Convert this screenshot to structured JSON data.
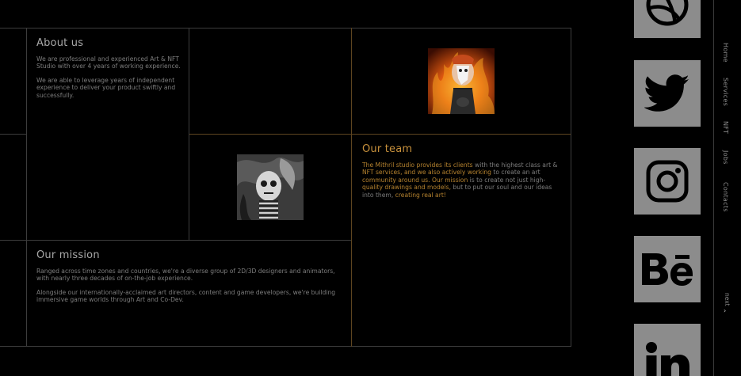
{
  "about": {
    "title": "About us",
    "p1": "We are professional and experienced Art & NFT Studio with over 4 years of working experience.",
    "p2": "We are able to leverage years of independent experience to deliver your product swiftly and successfully."
  },
  "team": {
    "title": "Our team",
    "p_a": "The Mithril studio provides its clients",
    "p_b": " with the highest class art & ",
    "p_c": "NFT services, and we also actively working",
    "p_d": " to create an art ",
    "p_e": "community around us. Our mission",
    "p_f": " is to create not just high-",
    "p_g": "quality drawings and models,",
    "p_h": " but to put our soul and our ideas into them, ",
    "p_i": "creating real art!"
  },
  "mission": {
    "title": "Our mission",
    "p1": "Ranged across time zones and countries, we're a diverse group of 2D/3D designers and animators, with nearly three decades of on-the-job experience.",
    "p2": "Alongside our internationally-acclaimed art directors, content and game developers, we're building immersive game worlds through Art and Co-Dev."
  },
  "nav": {
    "home": "Home",
    "services": "Services",
    "nft": "NFT",
    "jobs": "Jobs",
    "contacts": "Contacts",
    "next": "next",
    "next_arrow": "›"
  },
  "social": [
    "dribbble-icon",
    "twitter-icon",
    "instagram-icon",
    "behance-icon",
    "linkedin-icon"
  ],
  "colors": {
    "background": "#000000",
    "grid_line": "#3d3d3d",
    "accent": "#c8913c",
    "social_tile": "#8c8c8c"
  }
}
